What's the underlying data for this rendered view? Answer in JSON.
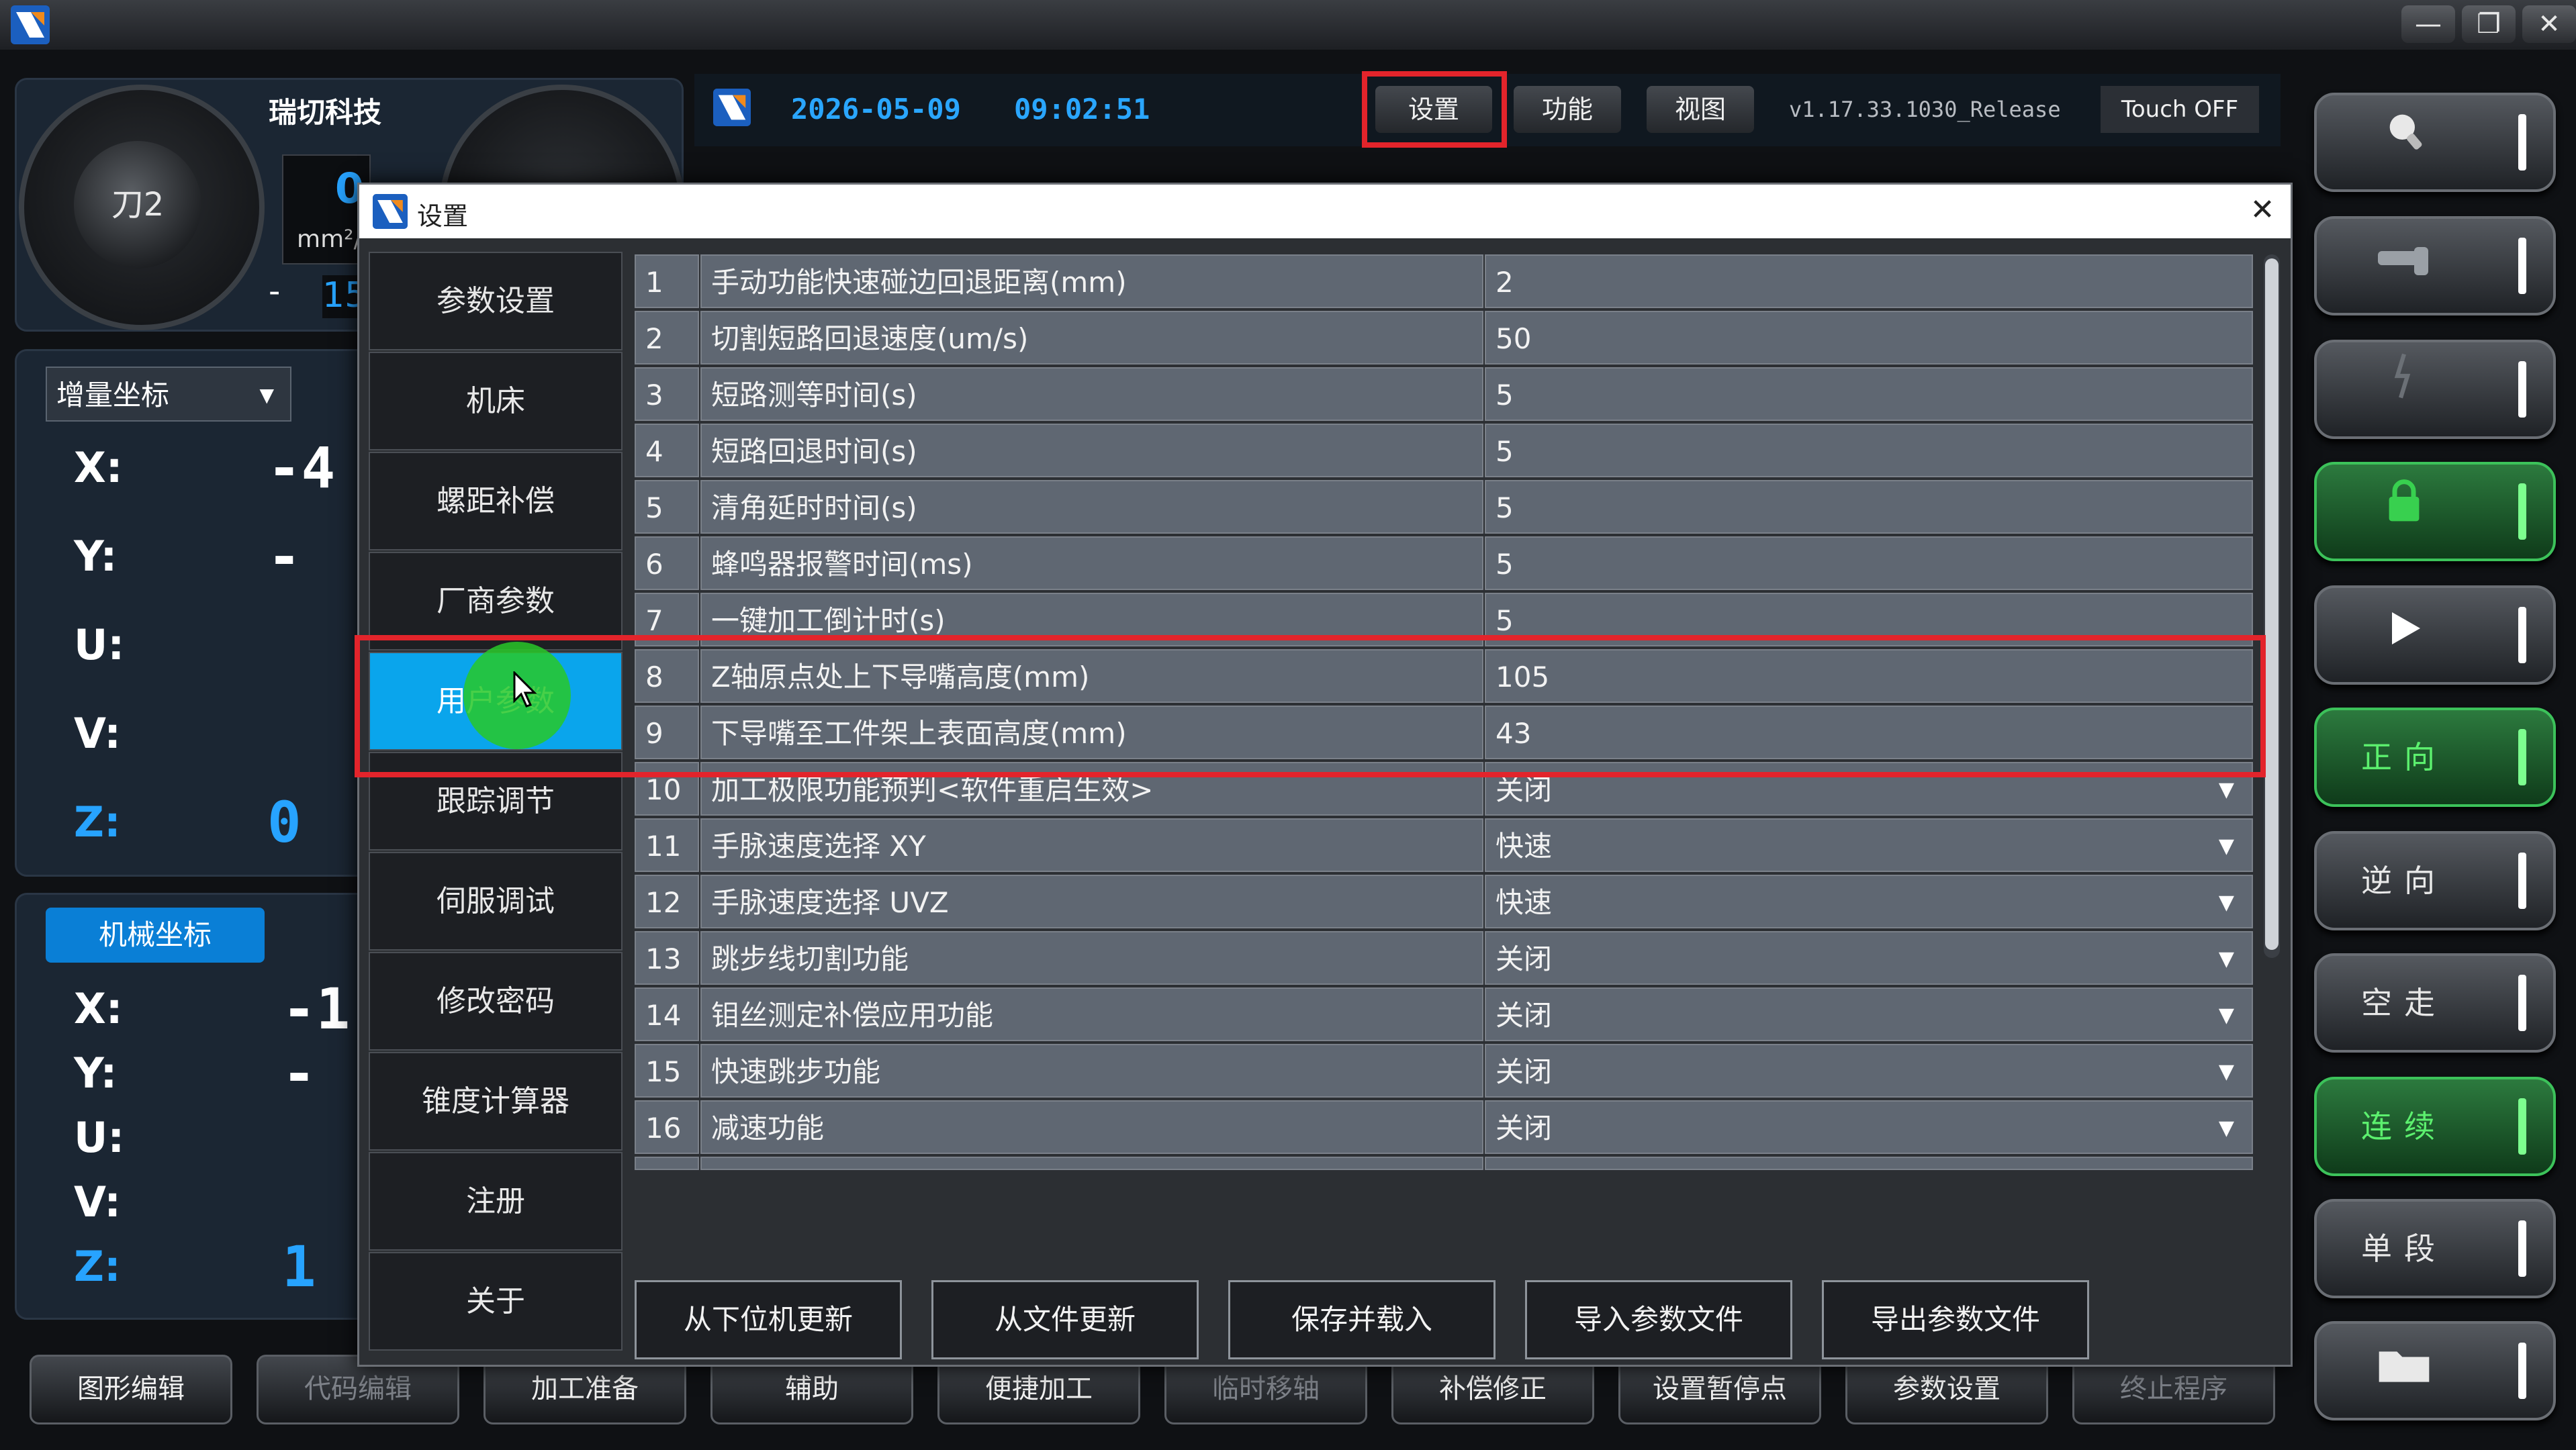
{
  "window": {
    "minimize": "—",
    "restore": "❐",
    "close": "✕"
  },
  "machine": {
    "company": "瑞切科技",
    "tool_label": "刀2",
    "speed_value": "0",
    "speed_unit": "mm²/",
    "small_value": "15",
    "small_sign": "-"
  },
  "coords": {
    "incremental_label": "增量坐标",
    "incremental_axes": [
      {
        "axis": "X:",
        "value": "-4"
      },
      {
        "axis": "Y:",
        "value": "-"
      },
      {
        "axis": "U:",
        "value": ""
      },
      {
        "axis": "V:",
        "value": ""
      },
      {
        "axis": "Z:",
        "value": "0"
      }
    ],
    "machine_label": "机械坐标",
    "machine_axes": [
      {
        "axis": "X:",
        "value": "-1"
      },
      {
        "axis": "Y:",
        "value": "-"
      },
      {
        "axis": "U:",
        "value": ""
      },
      {
        "axis": "V:",
        "value": ""
      },
      {
        "axis": "Z:",
        "value": "1"
      }
    ]
  },
  "header": {
    "date": "2026-05-09",
    "time": "09:02:51",
    "tabs": [
      "设置",
      "功能",
      "视图"
    ],
    "version": "v1.17.33.1030_Release",
    "touch": "Touch OFF"
  },
  "dialog": {
    "title": "设置",
    "close": "✕",
    "nav": [
      "参数设置",
      "机床",
      "螺距补偿",
      "厂商参数",
      "用户参数",
      "跟踪调节",
      "伺服调试",
      "修改密码",
      "锥度计算器",
      "注册",
      "关于"
    ],
    "active_nav": "用户参数",
    "rows": [
      {
        "no": "1",
        "name": "手动功能快速碰边回退距离(mm)",
        "value": "2",
        "dropdown": false
      },
      {
        "no": "2",
        "name": "切割短路回退速度(um/s)",
        "value": "50",
        "dropdown": false
      },
      {
        "no": "3",
        "name": "短路测等时间(s)",
        "value": "5",
        "dropdown": false
      },
      {
        "no": "4",
        "name": "短路回退时间(s)",
        "value": "5",
        "dropdown": false
      },
      {
        "no": "5",
        "name": "清角延时时间(s)",
        "value": "5",
        "dropdown": false
      },
      {
        "no": "6",
        "name": "蜂鸣器报警时间(ms)",
        "value": "5",
        "dropdown": false
      },
      {
        "no": "7",
        "name": "一键加工倒计时(s)",
        "value": "5",
        "dropdown": false
      },
      {
        "no": "8",
        "name": "Z轴原点处上下导嘴高度(mm)",
        "value": "105",
        "dropdown": false
      },
      {
        "no": "9",
        "name": "下导嘴至工件架上表面高度(mm)",
        "value": "43",
        "dropdown": false
      },
      {
        "no": "10",
        "name": "加工极限功能预判<软件重启生效>",
        "value": "关闭",
        "dropdown": true
      },
      {
        "no": "11",
        "name": "手脉速度选择 XY",
        "value": "快速",
        "dropdown": true
      },
      {
        "no": "12",
        "name": "手脉速度选择 UVZ",
        "value": "快速",
        "dropdown": true
      },
      {
        "no": "13",
        "name": "跳步线切割功能",
        "value": "关闭",
        "dropdown": true
      },
      {
        "no": "14",
        "name": "钼丝测定补偿应用功能",
        "value": "关闭",
        "dropdown": true
      },
      {
        "no": "15",
        "name": "快速跳步功能",
        "value": "关闭",
        "dropdown": true
      },
      {
        "no": "16",
        "name": "减速功能",
        "value": "关闭",
        "dropdown": true
      }
    ],
    "actions": [
      "从下位机更新",
      "从文件更新",
      "保存并载入",
      "导入参数文件",
      "导出参数文件"
    ]
  },
  "right_buttons": [
    {
      "label": "",
      "icon": "light-icon",
      "green": false
    },
    {
      "label": "",
      "icon": "water-icon",
      "green": false
    },
    {
      "label": "",
      "icon": "wire-icon",
      "green": false
    },
    {
      "label": "",
      "icon": "lock-icon",
      "green": true
    },
    {
      "label": "",
      "icon": "play-icon",
      "green": false
    },
    {
      "label": "正向",
      "icon": "",
      "green": true
    },
    {
      "label": "逆向",
      "icon": "",
      "green": false
    },
    {
      "label": "空走",
      "icon": "",
      "green": false
    },
    {
      "label": "连续",
      "icon": "",
      "green": true
    },
    {
      "label": "单段",
      "icon": "",
      "green": false
    },
    {
      "label": "",
      "icon": "folder-icon",
      "green": false
    }
  ],
  "bottom_toolbar": [
    "图形编辑",
    "代码编辑",
    "加工准备",
    "辅助",
    "便捷加工",
    "临时移轴",
    "补偿修正",
    "设置暂停点",
    "参数设置",
    "终止程序"
  ],
  "bottom_disabled": [
    "代码编辑",
    "临时移轴",
    "终止程序"
  ],
  "colors": {
    "accent_blue": "#0aa5ec",
    "highlight_red": "#e3242b",
    "cell_gray": "#5f6772",
    "status_green": "#3cc25a"
  }
}
